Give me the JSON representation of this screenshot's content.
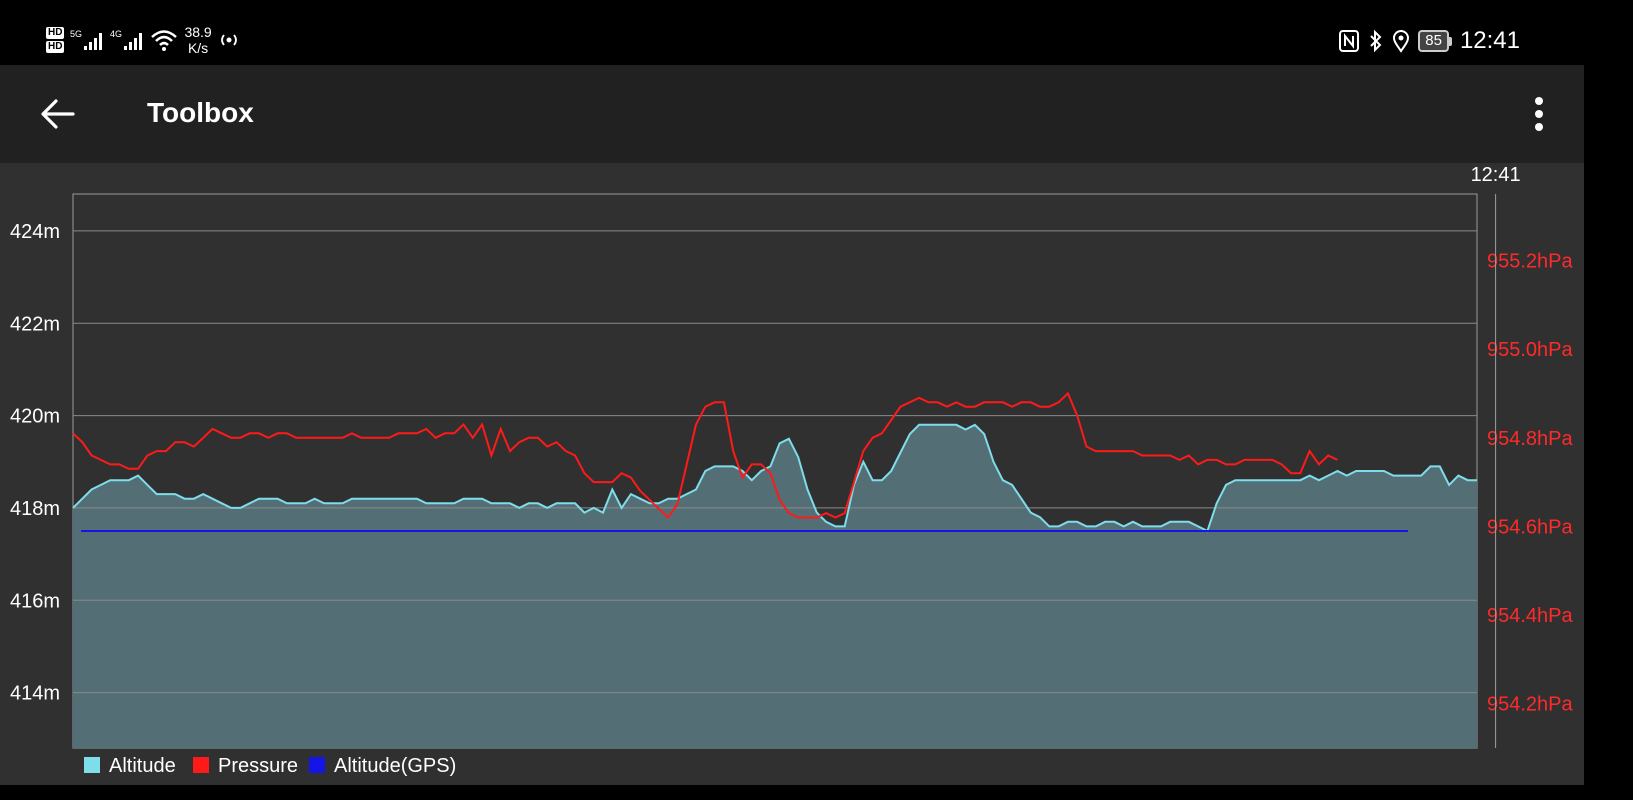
{
  "status_bar": {
    "sim1": "HD",
    "sim2": "HD",
    "net1": "5G",
    "net2": "4G",
    "speed_value": "38.9",
    "speed_unit": "K/s",
    "battery": "85",
    "time": "12:41",
    "icons": [
      "nfc-icon",
      "bluetooth-icon",
      "location-icon"
    ]
  },
  "app_bar": {
    "title": "Toolbox"
  },
  "chart_data": {
    "type": "line",
    "title": "",
    "marker": {
      "label": "12:41",
      "x_index": 153
    },
    "left_axis": {
      "unit": "m",
      "range": [
        412.8,
        424.8
      ],
      "ticks": [
        "424m",
        "422m",
        "420m",
        "418m",
        "416m",
        "414m"
      ],
      "tick_values": [
        424,
        422,
        420,
        418,
        416,
        414
      ]
    },
    "right_axis": {
      "unit": "hPa",
      "range": [
        954.1,
        955.35
      ],
      "ticks": [
        "955.2hPa",
        "955.0hPa",
        "954.8hPa",
        "954.6hPa",
        "954.4hPa",
        "954.2hPa"
      ],
      "tick_values": [
        955.2,
        955.0,
        954.8,
        954.6,
        954.4,
        954.2
      ]
    },
    "grid": true,
    "legend_position": "bottom-left",
    "colors": {
      "altitude_line": "#7FDCEB",
      "altitude_fill": "#546E75",
      "pressure": "#FF1A1A",
      "gps": "#1515E8",
      "grid": "#8A8A8A",
      "right_ticks": "#FF2A2A"
    },
    "series": [
      {
        "name": "Altitude",
        "axis": "left",
        "values": [
          418.0,
          418.2,
          418.4,
          418.5,
          418.6,
          418.6,
          418.6,
          418.7,
          418.5,
          418.3,
          418.3,
          418.3,
          418.2,
          418.2,
          418.3,
          418.2,
          418.1,
          418.0,
          418.0,
          418.1,
          418.2,
          418.2,
          418.2,
          418.1,
          418.1,
          418.1,
          418.2,
          418.1,
          418.1,
          418.1,
          418.2,
          418.2,
          418.2,
          418.2,
          418.2,
          418.2,
          418.2,
          418.2,
          418.1,
          418.1,
          418.1,
          418.1,
          418.2,
          418.2,
          418.2,
          418.1,
          418.1,
          418.1,
          418.0,
          418.1,
          418.1,
          418.0,
          418.1,
          418.1,
          418.1,
          417.9,
          418.0,
          417.9,
          418.4,
          418.0,
          418.3,
          418.2,
          418.1,
          418.1,
          418.2,
          418.2,
          418.3,
          418.4,
          418.8,
          418.9,
          418.9,
          418.9,
          418.8,
          418.6,
          418.8,
          418.9,
          419.4,
          419.5,
          419.1,
          418.4,
          417.9,
          417.7,
          417.6,
          417.6,
          418.5,
          419.0,
          418.6,
          418.6,
          418.8,
          419.2,
          419.6,
          419.8,
          419.8,
          419.8,
          419.8,
          419.8,
          419.7,
          419.8,
          419.6,
          419.0,
          418.6,
          418.5,
          418.2,
          417.9,
          417.8,
          417.6,
          417.6,
          417.7,
          417.7,
          417.6,
          417.6,
          417.7,
          417.7,
          417.6,
          417.7,
          417.6,
          417.6,
          417.6,
          417.7,
          417.7,
          417.7,
          417.6,
          417.5,
          418.1,
          418.5,
          418.6,
          418.6,
          418.6,
          418.6,
          418.6,
          418.6,
          418.6,
          418.6,
          418.7,
          418.6,
          418.7,
          418.8,
          418.7,
          418.8,
          418.8,
          418.8,
          418.8,
          418.7,
          418.7,
          418.7,
          418.7,
          418.9,
          418.9,
          418.5,
          418.7,
          418.6,
          418.6
        ]
      },
      {
        "name": "Pressure",
        "axis": "right",
        "values": [
          954.81,
          954.79,
          954.76,
          954.75,
          954.74,
          954.74,
          954.73,
          954.73,
          954.76,
          954.77,
          954.77,
          954.79,
          954.79,
          954.78,
          954.8,
          954.82,
          954.81,
          954.8,
          954.8,
          954.81,
          954.81,
          954.8,
          954.81,
          954.81,
          954.8,
          954.8,
          954.8,
          954.8,
          954.8,
          954.8,
          954.81,
          954.8,
          954.8,
          954.8,
          954.8,
          954.81,
          954.81,
          954.81,
          954.82,
          954.8,
          954.81,
          954.81,
          954.83,
          954.8,
          954.83,
          954.76,
          954.82,
          954.77,
          954.79,
          954.8,
          954.8,
          954.78,
          954.79,
          954.77,
          954.76,
          954.72,
          954.7,
          954.7,
          954.7,
          954.72,
          954.71,
          954.68,
          954.66,
          954.64,
          954.62,
          954.65,
          954.74,
          954.83,
          954.87,
          954.88,
          954.88,
          954.77,
          954.71,
          954.74,
          954.74,
          954.72,
          954.66,
          954.63,
          954.62,
          954.62,
          954.62,
          954.63,
          954.62,
          954.63,
          954.7,
          954.77,
          954.8,
          954.81,
          954.84,
          954.87,
          954.88,
          954.89,
          954.88,
          954.88,
          954.87,
          954.88,
          954.87,
          954.87,
          954.88,
          954.88,
          954.88,
          954.87,
          954.88,
          954.88,
          954.87,
          954.87,
          954.88,
          954.9,
          954.85,
          954.78,
          954.77,
          954.77,
          954.77,
          954.77,
          954.77,
          954.76,
          954.76,
          954.76,
          954.76,
          954.75,
          954.76,
          954.74,
          954.75,
          954.75,
          954.74,
          954.74,
          954.75,
          954.75,
          954.75,
          954.75,
          954.74,
          954.72,
          954.72,
          954.77,
          954.74,
          954.76,
          954.75
        ]
      },
      {
        "name": "Altitude(GPS)",
        "axis": "left",
        "values": [
          417.5,
          417.5
        ]
      }
    ],
    "legend": [
      "Altitude",
      "Pressure",
      "Altitude(GPS)"
    ]
  }
}
